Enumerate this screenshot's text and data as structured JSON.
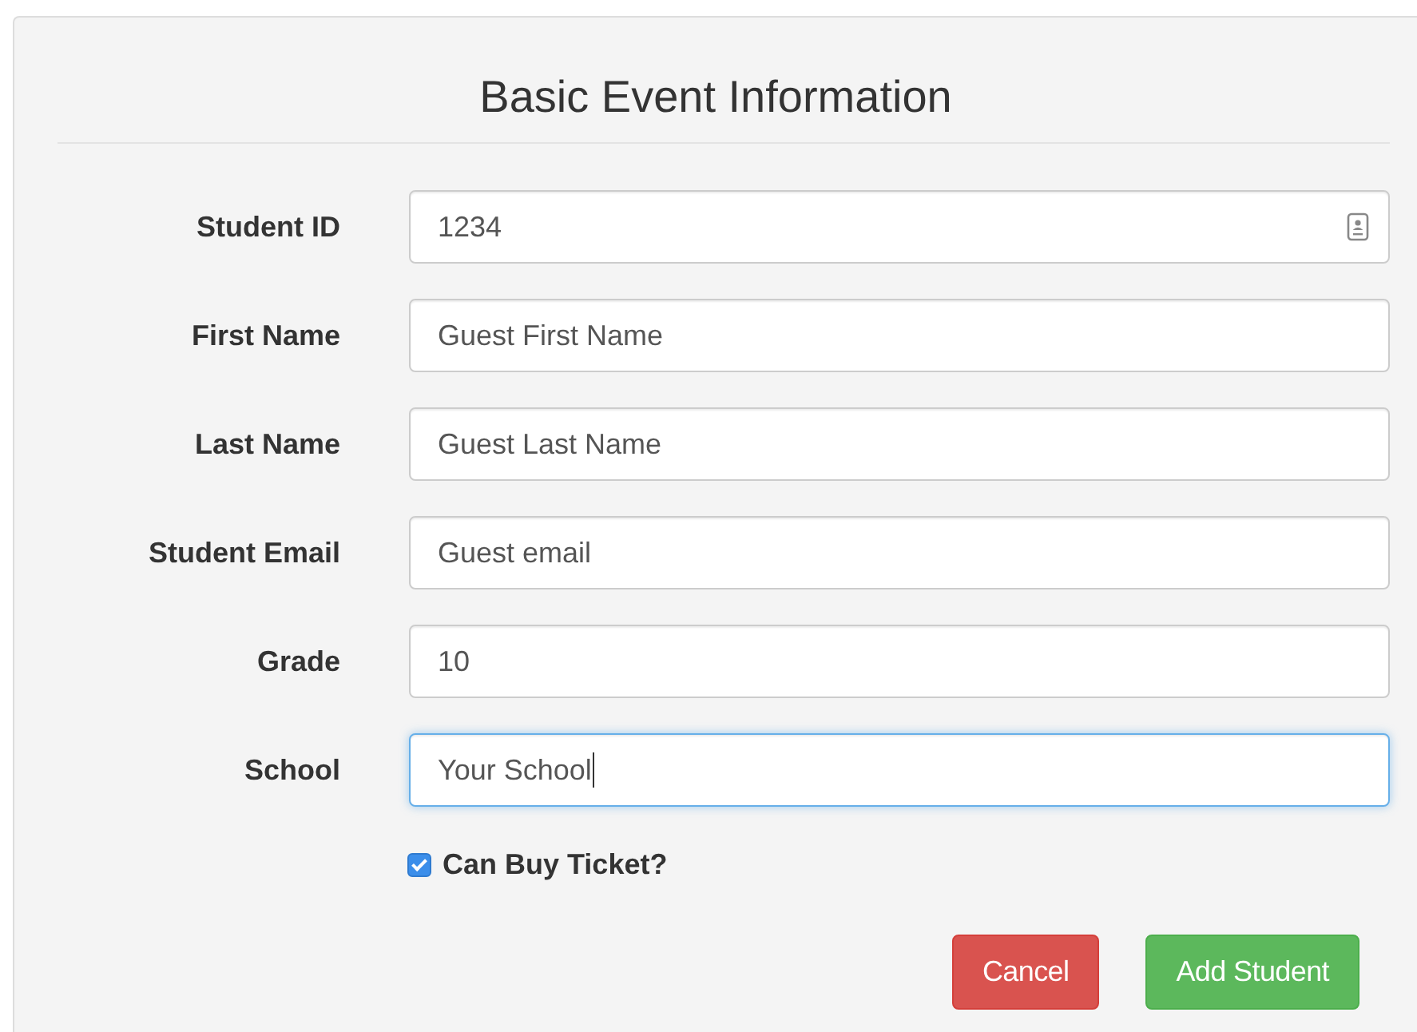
{
  "title": "Basic Event Information",
  "fields": [
    {
      "label": "Student ID",
      "value": "1234",
      "kind": "contact",
      "focused": false
    },
    {
      "label": "First Name",
      "value": "Guest First Name",
      "kind": "text",
      "focused": false
    },
    {
      "label": "Last Name",
      "value": "Guest Last Name",
      "kind": "text",
      "focused": false
    },
    {
      "label": "Student Email",
      "value": "Guest email",
      "kind": "text",
      "focused": false
    },
    {
      "label": "Grade",
      "value": "10",
      "kind": "text",
      "focused": false
    },
    {
      "label": "School",
      "value": "Your School",
      "kind": "text",
      "focused": true
    }
  ],
  "checkbox": {
    "label": "Can Buy Ticket?",
    "checked": true
  },
  "buttons": [
    {
      "label": "Cancel",
      "kind": "danger"
    },
    {
      "label": "Add Student",
      "kind": "success"
    }
  ]
}
